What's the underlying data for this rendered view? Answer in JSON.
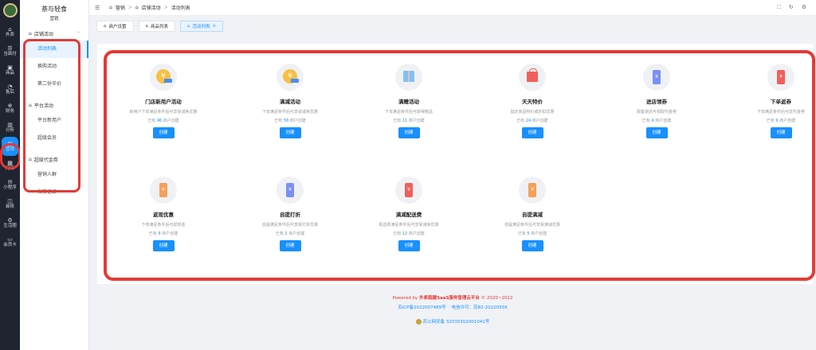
{
  "rail": {
    "items": [
      {
        "icon": "⌂",
        "label": "外卖"
      },
      {
        "icon": "☰",
        "label": "当面付"
      },
      {
        "icon": "▣",
        "label": "商品"
      },
      {
        "icon": "◔",
        "label": "售后"
      },
      {
        "icon": "⊕",
        "label": "财务"
      },
      {
        "icon": "▥",
        "label": "分析"
      },
      {
        "icon": "▤",
        "label": "营销"
      },
      {
        "icon": "▦",
        "label": "门店"
      },
      {
        "icon": "✉",
        "label": "小程序"
      },
      {
        "icon": "◫",
        "label": "装修"
      },
      {
        "icon": "⚙",
        "label": "生活圈"
      },
      {
        "icon": "▭",
        "label": "会员卡"
      }
    ]
  },
  "sidebar": {
    "store_name": "茶与轻食",
    "section": "营销",
    "groups": [
      {
        "label": "店铺活动",
        "items": [
          "活动列表",
          "换购活动",
          "第二份半价"
        ]
      },
      {
        "label": "平台活动",
        "items": [
          "平台新用户",
          "超级会员"
        ]
      },
      {
        "label": "超级代金券",
        "items": [
          "营销人群",
          "发放记录"
        ]
      }
    ]
  },
  "header": {
    "crumbs": [
      "营销",
      "店铺活动",
      "活动列表"
    ]
  },
  "tabs": [
    {
      "label": "商户设置"
    },
    {
      "label": "商品列表"
    },
    {
      "label": "活动列表",
      "close": "×"
    }
  ],
  "cards": [
    {
      "title": "门店新用户活动",
      "desc": "新用户下单满足条件后可享受减免优惠",
      "count_prefix": "已有",
      "count": "96",
      "count_suffix": "商户创建",
      "button": "创建"
    },
    {
      "title": "满减活动",
      "desc": "下单满足条件后可享受减免优惠",
      "count_prefix": "已有",
      "count": "58",
      "count_suffix": "商户创建",
      "button": "创建"
    },
    {
      "title": "满赠活动",
      "desc": "下单满足条件后可获得赠品",
      "count_prefix": "已有",
      "count": "11",
      "count_suffix": "商户创建",
      "button": "创建"
    },
    {
      "title": "天天特价",
      "desc": "指定商品特价或折扣优惠",
      "count_prefix": "已有",
      "count": "24",
      "count_suffix": "商户创建",
      "button": "创建"
    },
    {
      "title": "进店领券",
      "desc": "顾客进店可领取代金券",
      "count_prefix": "已有",
      "count": "4",
      "count_suffix": "商户创建",
      "button": "创建"
    },
    {
      "title": "下单返券",
      "desc": "下单满足条件后可返代金券",
      "count_prefix": "已有",
      "count": "9",
      "count_suffix": "商户创建",
      "button": "创建"
    },
    {
      "title": "返现优惠",
      "desc": "下单满足条件后可返现金",
      "count_prefix": "已有",
      "count": "9",
      "count_suffix": "商户创建",
      "button": "创建"
    },
    {
      "title": "自提打折",
      "desc": "自提满足条件后可享受打折优惠",
      "count_prefix": "已有",
      "count": "2",
      "count_suffix": "商户创建",
      "button": "创建"
    },
    {
      "title": "满减配送费",
      "desc": "配送费满足条件后可享受减免优惠",
      "count_prefix": "已有",
      "count": "12",
      "count_suffix": "商户创建",
      "button": "创建"
    },
    {
      "title": "自提满减",
      "desc": "自提满足条件后可享受满减优惠",
      "count_prefix": "已有",
      "count": "5",
      "count_suffix": "商户创建",
      "button": "创建"
    }
  ],
  "footer": {
    "powered_prefix": "Powered by",
    "brand": "外卖跑腿SaaS服务管理云平台",
    "copyright": "© 2020~2022",
    "icp": "苏ICP备2022007489号",
    "telecom": "电信许可：苏B2-20220556",
    "police": "苏公网安备 32030302001041号"
  },
  "colors": {
    "accent": "#1890ff",
    "highlight": "#e53935",
    "rail_bg": "#1f2430"
  }
}
